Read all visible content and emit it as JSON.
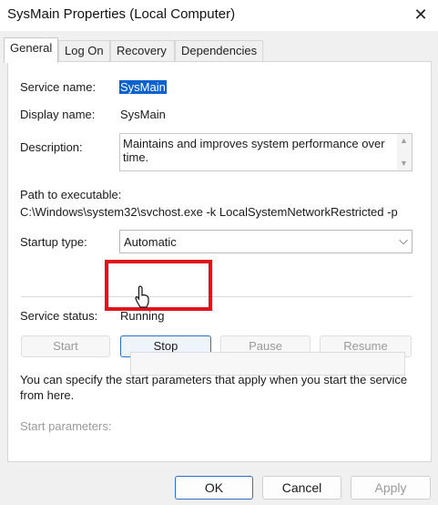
{
  "window": {
    "title": "SysMain Properties (Local Computer)",
    "close_glyph": "✕"
  },
  "tabs": [
    {
      "label": "General",
      "active": true
    },
    {
      "label": "Log On",
      "active": false
    },
    {
      "label": "Recovery",
      "active": false
    },
    {
      "label": "Dependencies",
      "active": false
    }
  ],
  "general": {
    "service_name_label": "Service name:",
    "service_name_value": "SysMain",
    "display_name_label": "Display name:",
    "display_name_value": "SysMain",
    "description_label": "Description:",
    "description_value": "Maintains and improves system performance over time.",
    "path_label": "Path to executable:",
    "path_value": "C:\\Windows\\system32\\svchost.exe -k LocalSystemNetworkRestricted -p",
    "startup_type_label": "Startup type:",
    "startup_type_value": "Automatic",
    "service_status_label": "Service status:",
    "service_status_value": "Running",
    "buttons": {
      "start": "Start",
      "stop": "Stop",
      "pause": "Pause",
      "resume": "Resume"
    },
    "hint_text": "You can specify the start parameters that apply when you start the service from here.",
    "start_parameters_label": "Start parameters:",
    "start_parameters_value": ""
  },
  "footer": {
    "ok": "OK",
    "cancel": "Cancel",
    "apply": "Apply"
  },
  "colors": {
    "highlight": "#e1141c",
    "selection": "#0a62d0",
    "focus": "#2a72c9"
  }
}
